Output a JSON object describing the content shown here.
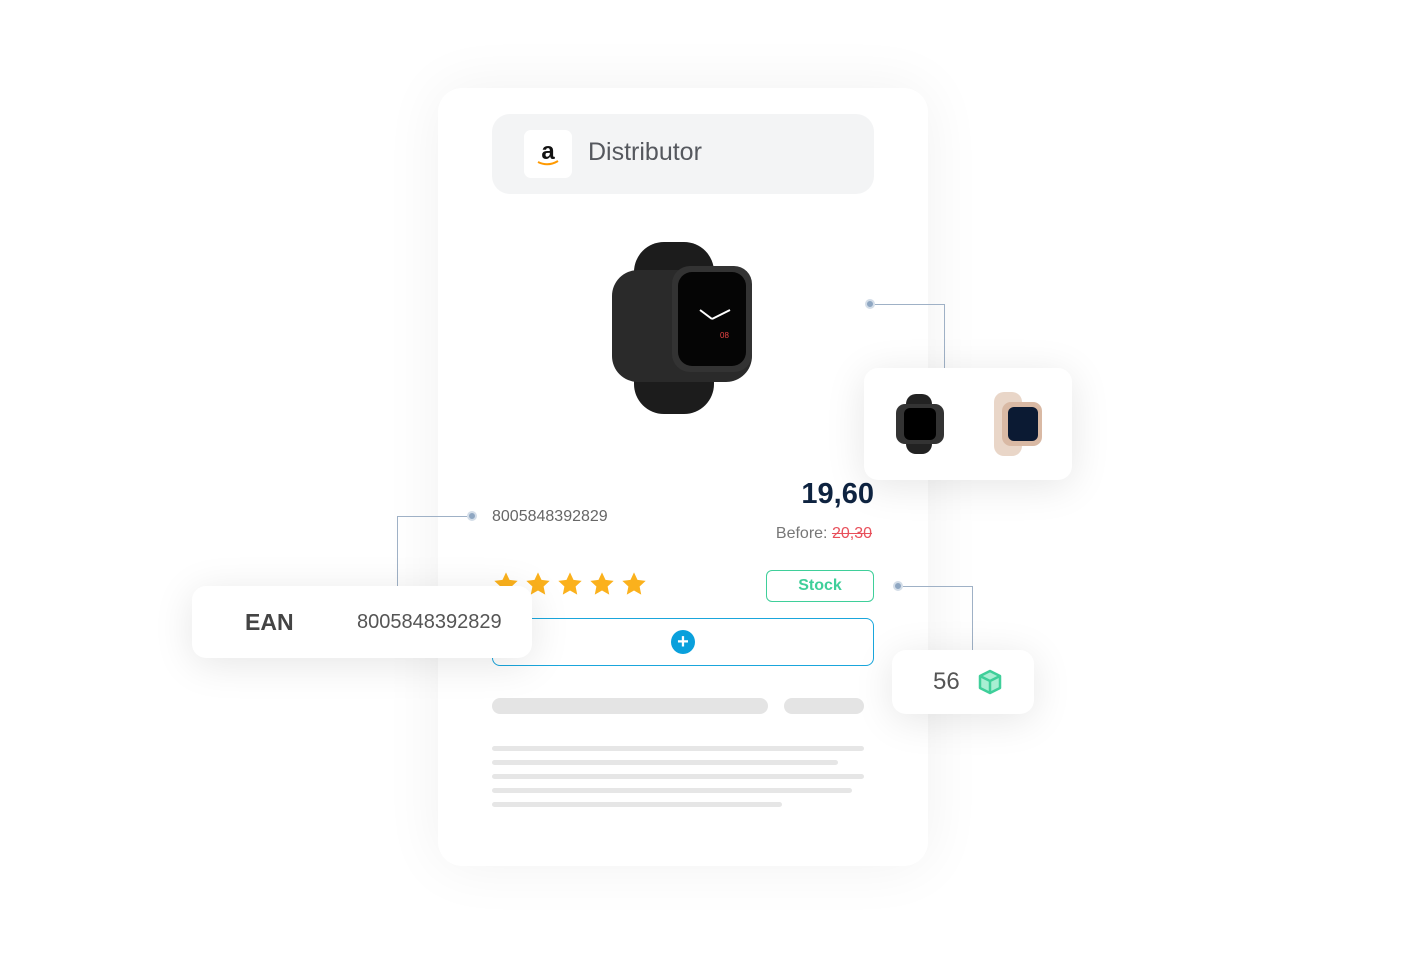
{
  "distributor": {
    "label": "Distributor",
    "logo": "amazon-logo"
  },
  "product": {
    "ean": "8005848392829",
    "price": "19,60",
    "before_label": "Before:",
    "before_price": "20,30",
    "rating": 5,
    "stock_label": "Stock"
  },
  "ean_card": {
    "label": "EAN",
    "value": "8005848392829"
  },
  "stock_card": {
    "count": "56",
    "icon": "box-icon"
  },
  "colors": {
    "accent": "#0aa0dc",
    "stock": "#3fcf9a",
    "price": "#0e2340",
    "old_price": "#e8505b",
    "star": "#fbb11c"
  }
}
